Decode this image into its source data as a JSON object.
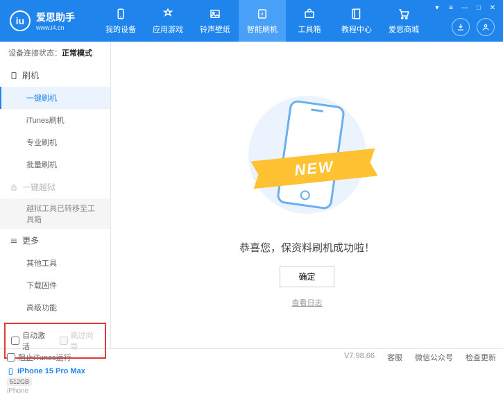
{
  "app": {
    "name": "爱思助手",
    "url": "www.i4.cn"
  },
  "nav": {
    "items": [
      {
        "label": "我的设备"
      },
      {
        "label": "应用游戏"
      },
      {
        "label": "铃声壁纸"
      },
      {
        "label": "智能刷机"
      },
      {
        "label": "工具箱"
      },
      {
        "label": "教程中心"
      },
      {
        "label": "爱思商城"
      }
    ]
  },
  "status": {
    "label": "设备连接状态：",
    "value": "正常模式"
  },
  "sidebar": {
    "s1": {
      "header": "刷机",
      "items": [
        "一键刷机",
        "iTunes刷机",
        "专业刷机",
        "批量刷机"
      ]
    },
    "s2": {
      "header": "一键越狱",
      "note": "越狱工具已转移至工具箱"
    },
    "s3": {
      "header": "更多",
      "items": [
        "其他工具",
        "下载固件",
        "高级功能"
      ]
    }
  },
  "checks": {
    "auto_activate": "自动激活",
    "skip_guide": "跳过向导"
  },
  "device": {
    "name": "iPhone 15 Pro Max",
    "storage": "512GB",
    "type": "iPhone"
  },
  "main": {
    "ribbon": "NEW",
    "success": "恭喜您，保资料刷机成功啦！",
    "ok": "确定",
    "log": "查看日志"
  },
  "footer": {
    "block_itunes": "阻止iTunes运行",
    "version": "V7.98.66",
    "links": [
      "客服",
      "微信公众号",
      "检查更新"
    ]
  }
}
